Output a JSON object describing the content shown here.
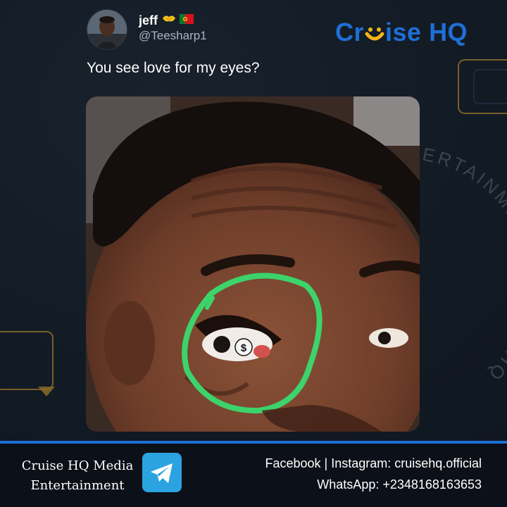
{
  "tweet": {
    "display_name": "jeff",
    "name_icons": [
      "handshake-emoji-icon",
      "portugal-flag-icon"
    ],
    "handle": "@Teesharp1",
    "text": "You see love for my eyes?",
    "avatar_icon": "user-avatar"
  },
  "brand": {
    "logo_part1": "Cr",
    "logo_part2": "ise HQ",
    "logo_accent_color": "#f2b51a",
    "logo_color": "#1f6fd6",
    "watermark_text": "ENTERTAINMENT CRUISE HQ"
  },
  "photo": {
    "description_icon": "meme-photo-eye-closeup",
    "highlight_color": "#3dd36b",
    "eye_symbol": "$"
  },
  "footer": {
    "media_name_line1": "Cruise HQ Media",
    "media_name_line2": "Entertainment",
    "telegram_icon": "telegram-icon",
    "social_text": "Facebook | Instagram: cruisehq.official",
    "whatsapp_text": "WhatsApp: +2348168163653",
    "accent_color": "#1f6fd6"
  }
}
